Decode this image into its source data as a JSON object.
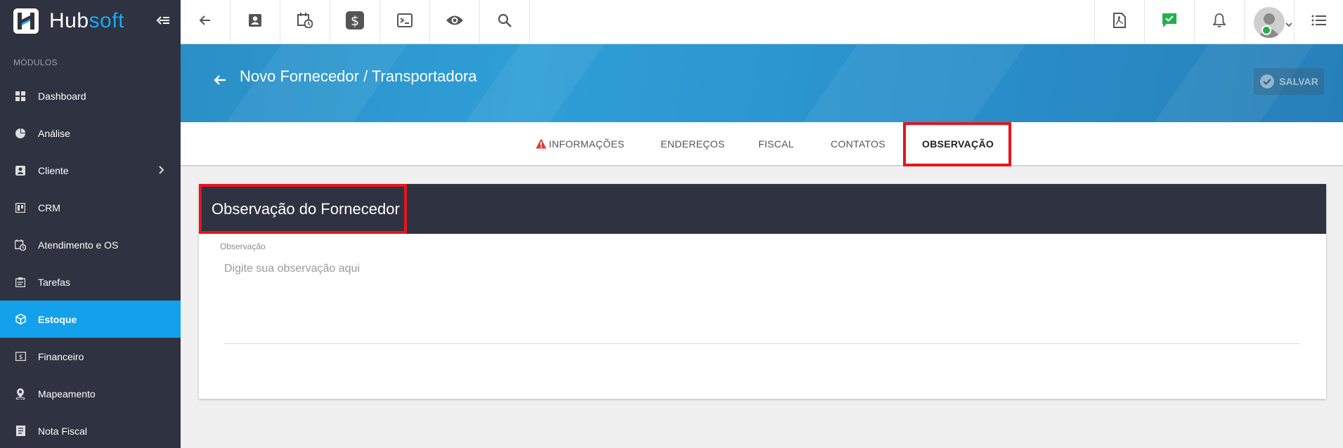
{
  "app": {
    "logo_hub": "Hub",
    "logo_soft": "soft"
  },
  "sidebar": {
    "section_label": "MÓDULOS",
    "items": [
      {
        "label": "Dashboard",
        "icon": "dashboard-grid-icon"
      },
      {
        "label": "Análise",
        "icon": "pie-chart-icon"
      },
      {
        "label": "Cliente",
        "icon": "contact-card-icon"
      },
      {
        "label": "CRM",
        "icon": "crm-board-icon"
      },
      {
        "label": "Atendimento e OS",
        "icon": "calendar-clock-icon"
      },
      {
        "label": "Tarefas",
        "icon": "task-clipboard-icon"
      },
      {
        "label": "Estoque",
        "icon": "package-box-icon"
      },
      {
        "label": "Financeiro",
        "icon": "money-bill-icon"
      },
      {
        "label": "Mapeamento",
        "icon": "map-pin-icon"
      },
      {
        "label": "Nota Fiscal",
        "icon": "invoice-doc-icon"
      }
    ],
    "active_item": "Estoque"
  },
  "topbar": {
    "left_icons": [
      "back-arrow-icon",
      "contact-card-icon",
      "calendar-clock-icon",
      "dollar-icon",
      "terminal-icon",
      "eye-icon",
      "search-icon"
    ],
    "right_icons": [
      "pdf-icon",
      "chat-check-icon",
      "bell-icon",
      "avatar",
      "menu-list-icon"
    ]
  },
  "banner": {
    "title": "Novo Fornecedor / Transportadora",
    "save_label": "SALVAR"
  },
  "tabs": [
    {
      "label": "INFORMAÇÕES",
      "warning": true
    },
    {
      "label": "ENDEREÇOS"
    },
    {
      "label": "FISCAL"
    },
    {
      "label": "CONTATOS"
    },
    {
      "label": "OBSERVAÇÃO",
      "active": true
    }
  ],
  "card": {
    "title": "Observação do Fornecedor",
    "field_label": "Observação",
    "field_placeholder": "Digite sua observação aqui",
    "field_value": ""
  },
  "colors": {
    "sidebar_bg": "#2e3241",
    "accent": "#13a1ec",
    "highlight": "#e8141c",
    "banner": "#2f9fd6"
  }
}
